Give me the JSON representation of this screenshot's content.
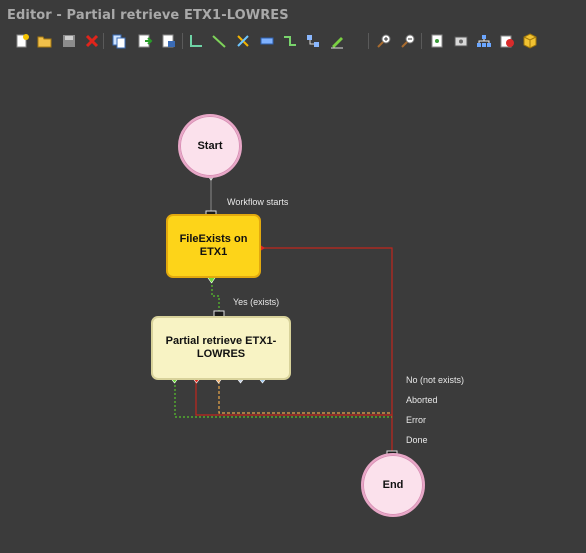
{
  "window": {
    "title": "Editor - Partial retrieve ETX1-LOWRES"
  },
  "toolbar": {
    "buttons": [
      {
        "icon": "new-icon"
      },
      {
        "icon": "open-folder-icon"
      },
      {
        "icon": "save-icon"
      },
      {
        "icon": "delete-icon"
      },
      {
        "icon": "copy-icon"
      },
      {
        "icon": "import-icon"
      },
      {
        "icon": "export-icon"
      },
      {
        "icon": "connector-icon"
      },
      {
        "icon": "line-icon"
      },
      {
        "icon": "cross-icon"
      },
      {
        "icon": "rectangle-icon"
      },
      {
        "icon": "route-icon"
      },
      {
        "icon": "node-link-icon"
      },
      {
        "icon": "pencil-icon"
      },
      {
        "icon": "zoom-in-icon"
      },
      {
        "icon": "zoom-out-icon"
      },
      {
        "icon": "script-icon"
      },
      {
        "icon": "settings-icon"
      },
      {
        "icon": "network-icon"
      },
      {
        "icon": "package-icon"
      },
      {
        "icon": "cube-icon"
      }
    ]
  },
  "workflow": {
    "start": {
      "label": "Start"
    },
    "file_exists": {
      "label": "FileExists on ETX1"
    },
    "partial_retrieve": {
      "label": "Partial retrieve ETX1-LOWRES"
    },
    "end": {
      "label": "End"
    },
    "edge_labels": {
      "workflow_starts": "Workflow starts",
      "yes_exists": "Yes (exists)",
      "no_not_exists": "No (not exists)",
      "aborted": "Aborted",
      "error": "Error",
      "done": "Done"
    },
    "colors": {
      "start_end_fill": "#fbe1ec",
      "file_exists_fill": "#fdd419",
      "partial_retrieve_fill": "#f8f3c4",
      "yes_wire": "#57c22c",
      "no_wire": "#c0261d",
      "error_wire": "#e8a64a"
    }
  }
}
